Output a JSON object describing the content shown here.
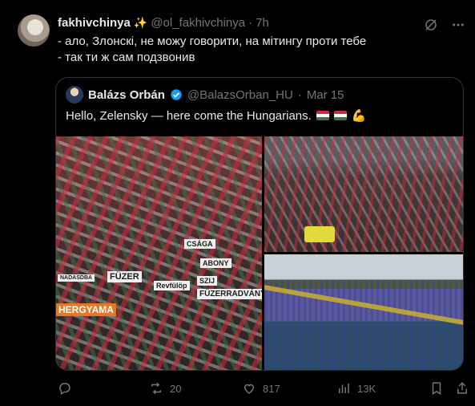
{
  "tweet": {
    "author_name": "fakhivchinya",
    "author_handle": "@ol_fakhivchinya",
    "separator": "·",
    "time": "7h",
    "lines": [
      "- ало, Злонскі, не можу говорити, на мітингу проти тебе",
      "- так ти ж сам подзвонив"
    ]
  },
  "quote": {
    "author_name": "Balázs Orbán",
    "author_handle": "@BalazsOrban_HU",
    "separator": "·",
    "date": "Mar 15",
    "text": "Hello, Zelensky — here come the Hungarians.",
    "emoji_muscle": "💪",
    "banners": [
      "SZIJ",
      "Revfülöp",
      "FÜZER",
      "FÜZERRADVÁNY",
      "HERGYAMA",
      "CSÁGA",
      "ABONY",
      "NADASDBA"
    ]
  },
  "actions": {
    "replies": "",
    "reposts": "20",
    "likes": "817",
    "views": "13K"
  },
  "colors": {
    "background": "#000000",
    "text": "#e7e9ea",
    "muted": "#71767b",
    "border": "#2f3336",
    "verified": "#1d9bf0"
  }
}
